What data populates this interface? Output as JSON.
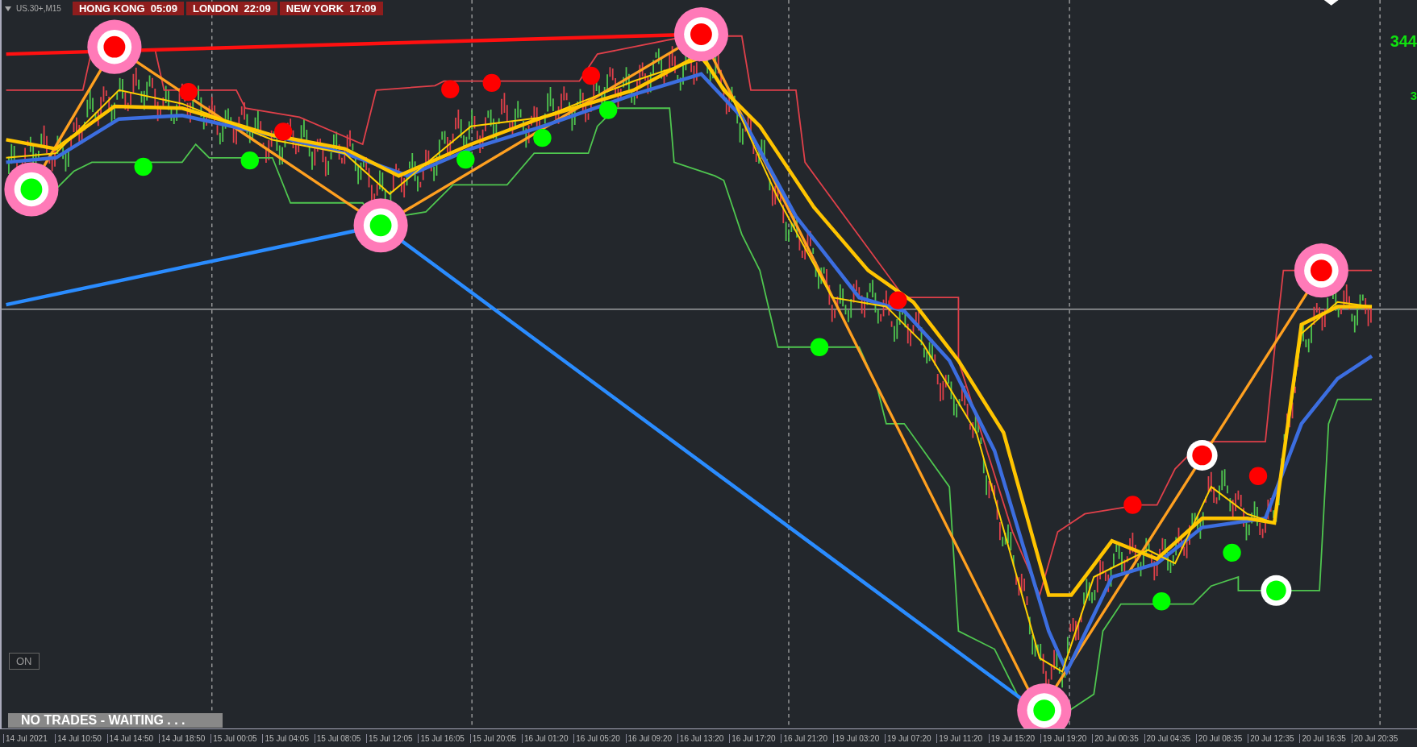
{
  "chart": {
    "symbol": "US.30+,M15",
    "sessions": [
      {
        "city": "HONG KONG",
        "time": "05:09"
      },
      {
        "city": "LONDON",
        "time": "22:09"
      },
      {
        "city": "NEW YORK",
        "time": "17:09"
      }
    ],
    "price_labels": [
      "344",
      "3"
    ],
    "toggle_button": "ON",
    "status_banner": "NO TRADES - WAITING . . ."
  },
  "time_axis": [
    "14 Jul 2021",
    "14 Jul 10:50",
    "14 Jul 14:50",
    "14 Jul 18:50",
    "15 Jul 00:05",
    "15 Jul 04:05",
    "15 Jul 08:05",
    "15 Jul 12:05",
    "15 Jul 16:05",
    "15 Jul 20:05",
    "16 Jul 01:20",
    "16 Jul 05:20",
    "16 Jul 09:20",
    "16 Jul 13:20",
    "16 Jul 17:20",
    "16 Jul 21:20",
    "19 Jul 03:20",
    "19 Jul 07:20",
    "19 Jul 11:20",
    "19 Jul 15:20",
    "19 Jul 19:20",
    "20 Jul 00:35",
    "20 Jul 04:35",
    "20 Jul 08:35",
    "20 Jul 12:35",
    "20 Jul 16:35",
    "20 Jul 20:35"
  ]
}
